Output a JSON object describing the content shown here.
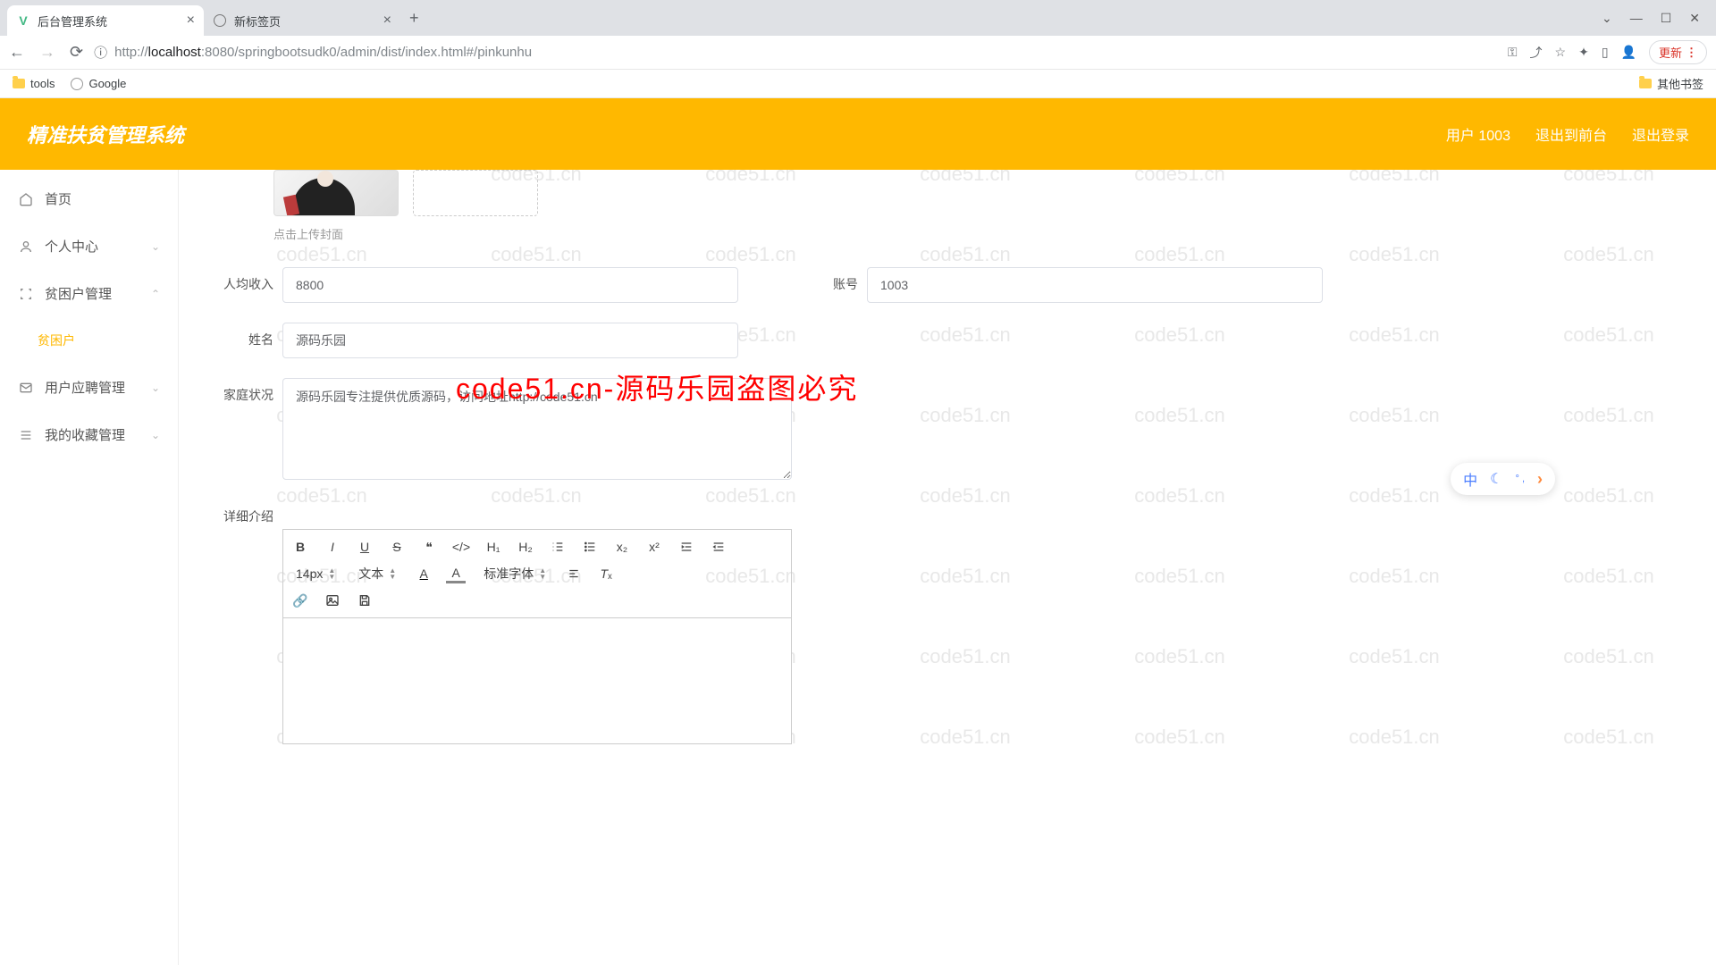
{
  "browser": {
    "tabs": [
      {
        "title": "后台管理系统"
      },
      {
        "title": "新标签页"
      }
    ],
    "url_prefix": "http://",
    "url_host": "localhost",
    "url_path": ":8080/springbootsudk0/admin/dist/index.html#/pinkunhu",
    "update_label": "更新",
    "bookmarks": {
      "tools": "tools",
      "google": "Google",
      "other": "其他书签"
    }
  },
  "header": {
    "title": "精准扶贫管理系统",
    "user": "用户 1003",
    "front": "退出到前台",
    "logout": "退出登录"
  },
  "sidebar": {
    "home": "首页",
    "personal": "个人中心",
    "poverty_mgmt": "贫困户管理",
    "poverty_sub": "贫困户",
    "recruit": "用户应聘管理",
    "favorites": "我的收藏管理"
  },
  "form": {
    "upload_tip": "点击上传封面",
    "income_label": "人均收入",
    "income_value": "8800",
    "account_label": "账号",
    "account_value": "1003",
    "name_label": "姓名",
    "name_value": "源码乐园",
    "family_label": "家庭状况",
    "family_value": "源码乐园专注提供优质源码，访问地址http://code51.cn",
    "details_label": "详细介绍"
  },
  "editor": {
    "font_size": "14px",
    "text_style": "文本",
    "font_family": "标准字体"
  },
  "watermark": {
    "text": "code51.cn",
    "banner": "code51.cn-源码乐园盗图必究"
  },
  "ime": {
    "zh": "中"
  }
}
